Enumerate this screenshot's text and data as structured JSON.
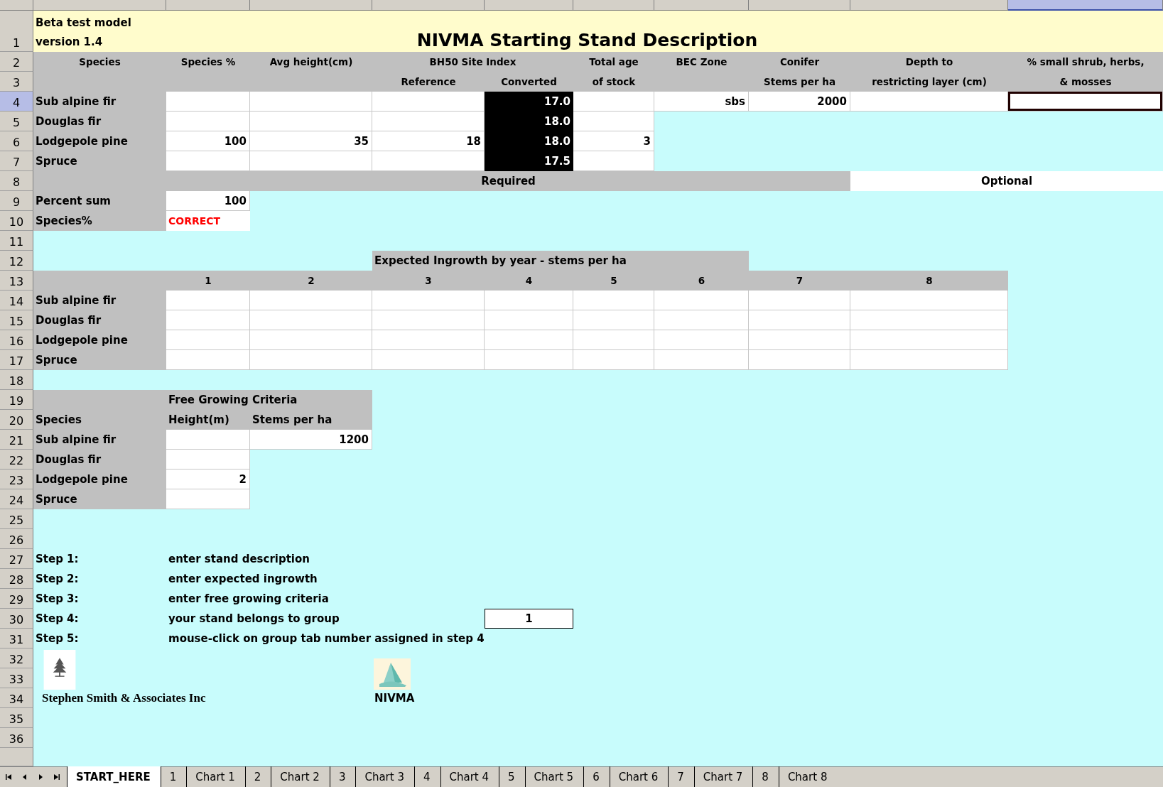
{
  "sheet": {
    "rows": [
      {
        "number": "1",
        "cells": [
          {
            "kind": "banner_note",
            "text": "Beta test model\nversion 1.4"
          },
          {
            "kind": "banner_title",
            "text": "NIVMA Starting Stand Description"
          },
          {
            "kind": "banner_title"
          },
          {
            "kind": "banner_title"
          },
          {
            "kind": "banner_title"
          },
          {
            "kind": "banner_title"
          },
          {
            "kind": "banner_title"
          },
          {
            "kind": "banner_title"
          },
          {
            "kind": "banner_title"
          },
          {
            "kind": "banner"
          }
        ]
      },
      {
        "number": "2",
        "cells": [
          {
            "kind": "header",
            "text": "Species"
          },
          {
            "kind": "header",
            "text": "Species %"
          },
          {
            "kind": "header",
            "text": "Avg height(cm)"
          },
          {
            "kind": "group_header",
            "text": "BH50 Site Index"
          },
          {
            "kind": "group_header"
          },
          {
            "kind": "header",
            "text": "Total age"
          },
          {
            "kind": "header",
            "text": "BEC Zone"
          },
          {
            "kind": "header",
            "text": "Conifer"
          },
          {
            "kind": "header",
            "text": "Depth to"
          },
          {
            "kind": "header",
            "text": "% small shrub, herbs,"
          }
        ]
      },
      {
        "number": "3",
        "cells": [
          {
            "kind": "header"
          },
          {
            "kind": "header"
          },
          {
            "kind": "header"
          },
          {
            "kind": "header",
            "text": "Reference"
          },
          {
            "kind": "header",
            "text": "Converted"
          },
          {
            "kind": "header",
            "text": "of stock"
          },
          {
            "kind": "header"
          },
          {
            "kind": "header",
            "text": "Stems per ha"
          },
          {
            "kind": "header",
            "text": "restricting layer (cm)"
          },
          {
            "kind": "header",
            "text": "& mosses"
          }
        ]
      },
      {
        "number": "4",
        "cells": [
          {
            "kind": "label",
            "text": "Sub alpine fir"
          },
          {
            "kind": "input",
            "selected": false
          },
          {
            "kind": "input",
            "selected": false
          },
          {
            "kind": "input",
            "selected": false
          },
          {
            "kind": "result",
            "text": "17.0"
          },
          {
            "kind": "input",
            "selected": false
          },
          {
            "kind": "input",
            "text": "sbs",
            "selected": false
          },
          {
            "kind": "input",
            "text": "2000",
            "selected": false
          },
          {
            "kind": "input",
            "selected": false
          },
          {
            "kind": "input",
            "selected": true
          }
        ]
      },
      {
        "number": "5",
        "cells": [
          {
            "kind": "label",
            "text": "Douglas fir"
          },
          {
            "kind": "input",
            "selected": false
          },
          {
            "kind": "input",
            "selected": false
          },
          {
            "kind": "input",
            "selected": false
          },
          {
            "kind": "result",
            "text": "18.0"
          },
          {
            "kind": "input",
            "selected": false
          }
        ]
      },
      {
        "number": "6",
        "cells": [
          {
            "kind": "label",
            "text": "Lodgepole pine"
          },
          {
            "kind": "input",
            "text": "100",
            "selected": false
          },
          {
            "kind": "input",
            "text": "35",
            "selected": false
          },
          {
            "kind": "input",
            "text": "18",
            "selected": false
          },
          {
            "kind": "result",
            "text": "18.0"
          },
          {
            "kind": "input",
            "text": "3",
            "selected": false
          }
        ]
      },
      {
        "number": "7",
        "cells": [
          {
            "kind": "label",
            "text": "Spruce"
          },
          {
            "kind": "input",
            "selected": false
          },
          {
            "kind": "input",
            "selected": false
          },
          {
            "kind": "input",
            "selected": false
          },
          {
            "kind": "result",
            "text": "17.5"
          },
          {
            "kind": "input",
            "selected": false
          }
        ]
      },
      {
        "number": "8",
        "cells": [
          {
            "kind": "label"
          },
          {
            "kind": "section",
            "text": "Required"
          },
          {
            "kind": "section"
          },
          {
            "kind": "section"
          },
          {
            "kind": "section"
          },
          {
            "kind": "section"
          },
          {
            "kind": "section"
          },
          {
            "kind": "section"
          },
          {
            "kind": "optional",
            "text": "Optional"
          },
          {
            "kind": "optional"
          }
        ]
      },
      {
        "number": "9",
        "cells": [
          {
            "kind": "label",
            "text": "Percent sum"
          },
          {
            "kind": "input",
            "text": "100",
            "selected": false
          }
        ]
      },
      {
        "number": "10",
        "cells": [
          {
            "kind": "label",
            "text": "Species%"
          },
          {
            "kind": "status",
            "text": "CORRECT"
          }
        ]
      },
      {
        "number": "11"
      },
      {
        "number": "12",
        "cells": [
          {
            "kind": "blank"
          },
          {
            "kind": "blank"
          },
          {
            "kind": "blank"
          },
          {
            "kind": "heading_left",
            "text": "Expected Ingrowth by year - stems per ha"
          },
          {
            "kind": "heading_left"
          },
          {
            "kind": "heading_left"
          },
          {
            "kind": "heading_left"
          }
        ]
      },
      {
        "number": "13",
        "cells": [
          {
            "kind": "label"
          },
          {
            "kind": "header",
            "text": "1"
          },
          {
            "kind": "header",
            "text": "2"
          },
          {
            "kind": "header",
            "text": "3"
          },
          {
            "kind": "header",
            "text": "4"
          },
          {
            "kind": "header",
            "text": "5"
          },
          {
            "kind": "header",
            "text": "6"
          },
          {
            "kind": "header",
            "text": "7"
          },
          {
            "kind": "header",
            "text": "8"
          }
        ]
      },
      {
        "number": "14",
        "cells": [
          {
            "kind": "label",
            "text": "Sub alpine fir"
          },
          {
            "kind": "input",
            "selected": false
          },
          {
            "kind": "input",
            "selected": false
          },
          {
            "kind": "input",
            "selected": false
          },
          {
            "kind": "input",
            "selected": false
          },
          {
            "kind": "input",
            "selected": false
          },
          {
            "kind": "input",
            "selected": false
          },
          {
            "kind": "input",
            "selected": false
          },
          {
            "kind": "input",
            "selected": false
          }
        ]
      },
      {
        "number": "15",
        "cells": [
          {
            "kind": "label",
            "text": "Douglas fir"
          },
          {
            "kind": "input",
            "selected": false
          },
          {
            "kind": "input",
            "selected": false
          },
          {
            "kind": "input",
            "selected": false
          },
          {
            "kind": "input",
            "selected": false
          },
          {
            "kind": "input",
            "selected": false
          },
          {
            "kind": "input",
            "selected": false
          },
          {
            "kind": "input",
            "selected": false
          },
          {
            "kind": "input",
            "selected": false
          }
        ]
      },
      {
        "number": "16",
        "cells": [
          {
            "kind": "label",
            "text": "Lodgepole pine"
          },
          {
            "kind": "input",
            "selected": false
          },
          {
            "kind": "input",
            "selected": false
          },
          {
            "kind": "input",
            "selected": false
          },
          {
            "kind": "input",
            "selected": false
          },
          {
            "kind": "input",
            "selected": false
          },
          {
            "kind": "input",
            "selected": false
          },
          {
            "kind": "input",
            "selected": false
          },
          {
            "kind": "input",
            "selected": false
          }
        ]
      },
      {
        "number": "17",
        "cells": [
          {
            "kind": "label",
            "text": "Spruce"
          },
          {
            "kind": "input",
            "selected": false
          },
          {
            "kind": "input",
            "selected": false
          },
          {
            "kind": "input",
            "selected": false
          },
          {
            "kind": "input",
            "selected": false
          },
          {
            "kind": "input",
            "selected": false
          },
          {
            "kind": "input",
            "selected": false
          },
          {
            "kind": "input",
            "selected": false
          },
          {
            "kind": "input",
            "selected": false
          }
        ]
      },
      {
        "number": "18"
      },
      {
        "number": "19",
        "cells": [
          {
            "kind": "label"
          },
          {
            "kind": "heading_left",
            "text": "Free Growing Criteria"
          },
          {
            "kind": "heading_left"
          }
        ]
      },
      {
        "number": "20",
        "cells": [
          {
            "kind": "label",
            "text": "Species"
          },
          {
            "kind": "heading_left",
            "text": "Height(m)"
          },
          {
            "kind": "heading_left",
            "text": "Stems per ha"
          }
        ]
      },
      {
        "number": "21",
        "cells": [
          {
            "kind": "label",
            "text": "Sub alpine fir"
          },
          {
            "kind": "input",
            "selected": false
          },
          {
            "kind": "input",
            "text": "1200",
            "selected": false
          }
        ]
      },
      {
        "number": "22",
        "cells": [
          {
            "kind": "label",
            "text": "Douglas fir"
          },
          {
            "kind": "input",
            "selected": false
          }
        ]
      },
      {
        "number": "23",
        "cells": [
          {
            "kind": "label",
            "text": "Lodgepole pine"
          },
          {
            "kind": "input",
            "text": "2",
            "selected": false
          }
        ]
      },
      {
        "number": "24",
        "cells": [
          {
            "kind": "label",
            "text": "Spruce"
          },
          {
            "kind": "input",
            "selected": false
          }
        ]
      },
      {
        "number": "25"
      },
      {
        "number": "26"
      },
      {
        "number": "27",
        "cells": [
          {
            "kind": "step",
            "text": "Step 1:"
          },
          {
            "kind": "step",
            "text": "enter stand description"
          }
        ]
      },
      {
        "number": "28",
        "cells": [
          {
            "kind": "step",
            "text": "Step 2:"
          },
          {
            "kind": "step",
            "text": "enter expected ingrowth"
          }
        ]
      },
      {
        "number": "29",
        "cells": [
          {
            "kind": "step",
            "text": "Step 3:"
          },
          {
            "kind": "step",
            "text": "enter free growing criteria"
          }
        ]
      },
      {
        "number": "30",
        "cells": [
          {
            "kind": "step",
            "text": "Step 4:"
          },
          {
            "kind": "step",
            "text": "your stand belongs to group"
          },
          {
            "kind": "blank"
          },
          {
            "kind": "blank"
          },
          {
            "kind": "boxed",
            "text": "1"
          }
        ]
      },
      {
        "number": "31",
        "cells": [
          {
            "kind": "step",
            "text": "Step 5:"
          },
          {
            "kind": "step",
            "text": "mouse-click on group tab number assigned in step 4"
          }
        ]
      },
      {
        "number": "32",
        "cells": [
          {
            "kind": "tree_logo"
          },
          {
            "kind": "blank"
          },
          {
            "kind": "blank"
          },
          {
            "kind": "mountain_logo"
          }
        ]
      },
      {
        "number": "33"
      },
      {
        "number": "34",
        "cells": [
          {
            "kind": "serif_caption",
            "text": "Stephen Smith & Associates Inc"
          },
          {
            "kind": "blank"
          },
          {
            "kind": "blank"
          },
          {
            "kind": "caption",
            "text": "NIVMA"
          }
        ]
      },
      {
        "number": "35"
      },
      {
        "number": "36"
      },
      {}
    ]
  },
  "sheet_tabs": [
    {
      "label": "START_HERE",
      "selected": true
    },
    {
      "label": "1",
      "selected": false
    },
    {
      "label": "Chart 1",
      "selected": false
    },
    {
      "label": "2",
      "selected": false
    },
    {
      "label": "Chart 2",
      "selected": false
    },
    {
      "label": "3",
      "selected": false
    },
    {
      "label": "Chart 3",
      "selected": false
    },
    {
      "label": "4",
      "selected": false
    },
    {
      "label": "Chart 4",
      "selected": false
    },
    {
      "label": "5",
      "selected": false
    },
    {
      "label": "Chart 5",
      "selected": false
    },
    {
      "label": "6",
      "selected": false
    },
    {
      "label": "Chart 6",
      "selected": false
    },
    {
      "label": "7",
      "selected": false
    },
    {
      "label": "Chart 7",
      "selected": false
    },
    {
      "label": "8",
      "selected": false
    },
    {
      "label": "Chart 8",
      "selected": false
    }
  ]
}
